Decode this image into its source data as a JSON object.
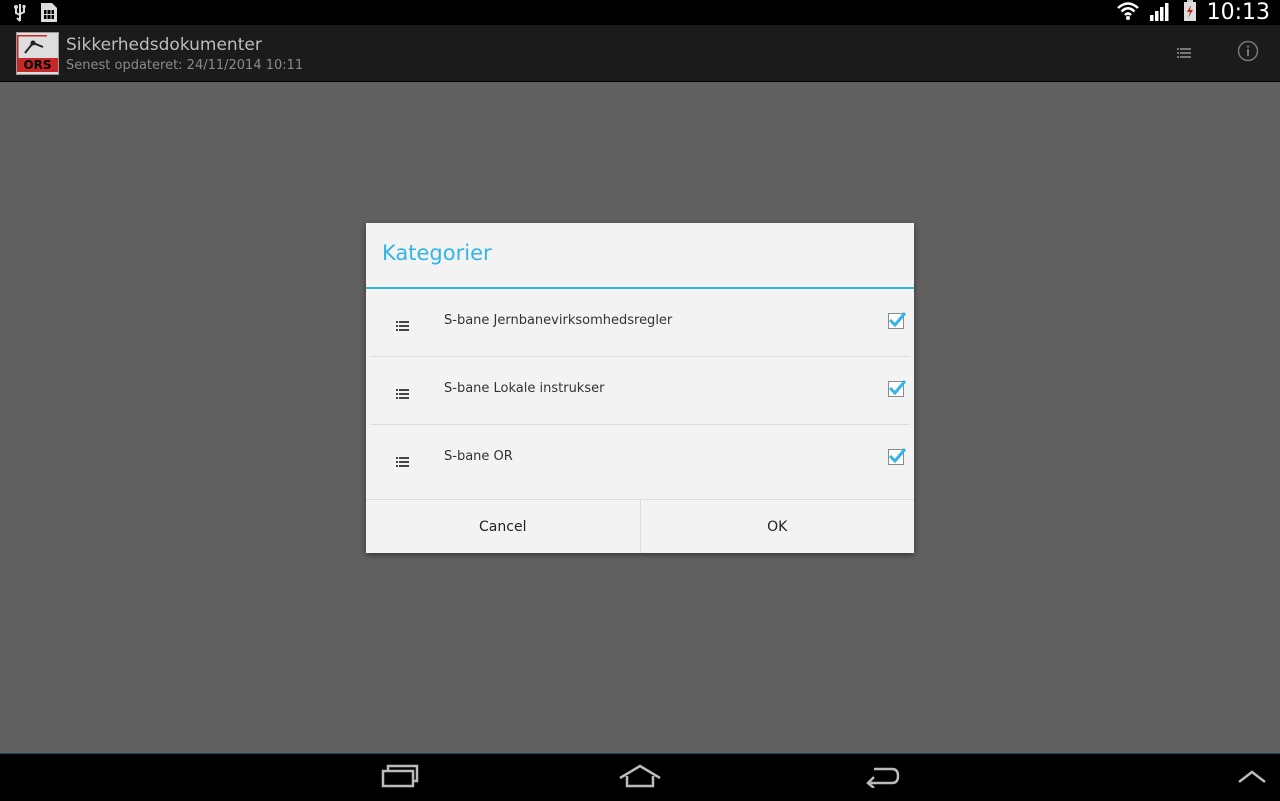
{
  "status_bar": {
    "left_icons": [
      "usb-icon",
      "sim-card-icon"
    ],
    "right_icons": [
      "wifi-icon",
      "signal-icon",
      "battery-icon"
    ],
    "time": "10:13"
  },
  "action_bar": {
    "logo_text": "ORS",
    "title": "Sikkerhedsdokumenter",
    "subtitle": "Senest opdateret: 24/11/2014 10:11",
    "actions": [
      "list-icon",
      "info-icon"
    ]
  },
  "dialog": {
    "title": "Kategorier",
    "accent_color": "#33b5e5",
    "categories": [
      {
        "label": "S-bane Jernbanevirksomhedsregler",
        "checked": true
      },
      {
        "label": "S-bane Lokale instrukser",
        "checked": true
      },
      {
        "label": "S-bane OR",
        "checked": true
      }
    ],
    "cancel_label": "Cancel",
    "ok_label": "OK"
  },
  "nav_bar": {
    "buttons": [
      "recent-apps-icon",
      "home-icon",
      "back-icon",
      "chevron-up-icon"
    ]
  }
}
